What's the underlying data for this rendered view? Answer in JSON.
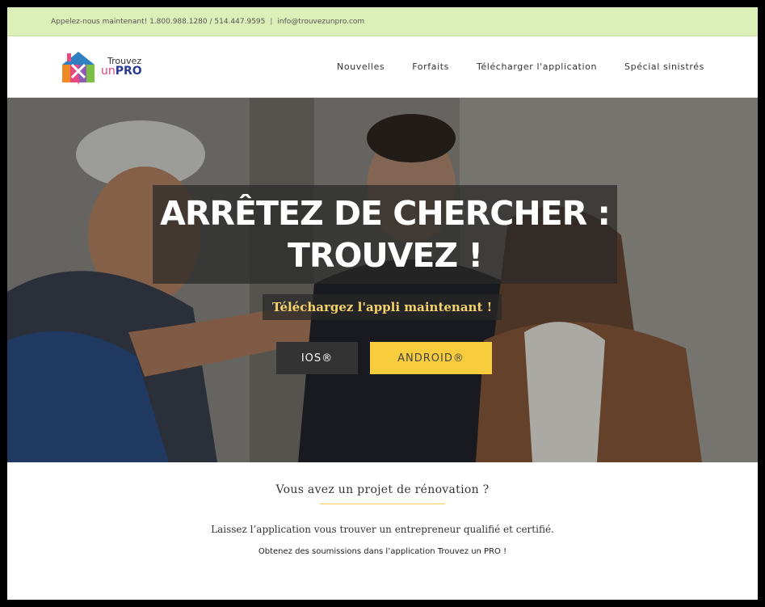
{
  "topbar": {
    "phone_text": "Appelez-nous maintenant! 1.800.988.1280 / 514.447.9595",
    "separator": "|",
    "email": "info@trouvezunpro.com"
  },
  "logo": {
    "line1": "Trouvez",
    "line2_un": "un",
    "line2_pro": "PRO"
  },
  "nav": {
    "items": [
      {
        "label": "Nouvelles"
      },
      {
        "label": "Forfaits"
      },
      {
        "label": "Télécharger l'application"
      },
      {
        "label": "Spécial sinistrés"
      }
    ]
  },
  "hero": {
    "headline_line1": "ARRÊTEZ DE CHERCHER :",
    "headline_line2": "TROUVEZ !",
    "subheadline": "Téléchargez l'appli maintenant !",
    "ios_button": "IOS®",
    "android_button": "ANDROID®"
  },
  "section": {
    "title": "Vous avez un projet de rénovation ?",
    "paragraph1": "Laissez l’application vous trouver un entrepreneur qualifié et certifié.",
    "paragraph2": "Obtenez des soumissions dans l’application Trouvez un PRO !"
  },
  "colors": {
    "topbar_bg": "#dcefb8",
    "accent_yellow": "#f7cc3d",
    "subheadline_text": "#f4d36c",
    "dark_button": "#333333"
  }
}
